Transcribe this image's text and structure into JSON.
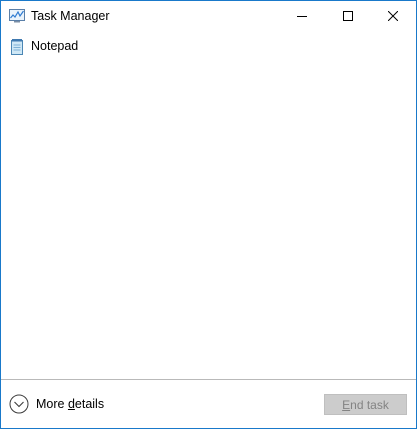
{
  "window": {
    "title": "Task Manager",
    "app_icon": "task-manager-icon",
    "border_color": "#1979ca"
  },
  "caption_buttons": {
    "minimize_icon": "minimize-icon",
    "maximize_icon": "maximize-icon",
    "close_icon": "close-icon"
  },
  "processes": [
    {
      "label": "Notepad",
      "icon": "notepad-icon"
    }
  ],
  "footer": {
    "more_details_prefix": "More ",
    "more_details_accel": "d",
    "more_details_suffix": "etails",
    "more_details_icon": "chevron-down-circle-icon",
    "end_task_accel": "E",
    "end_task_suffix": "nd task",
    "end_task_enabled": false
  }
}
